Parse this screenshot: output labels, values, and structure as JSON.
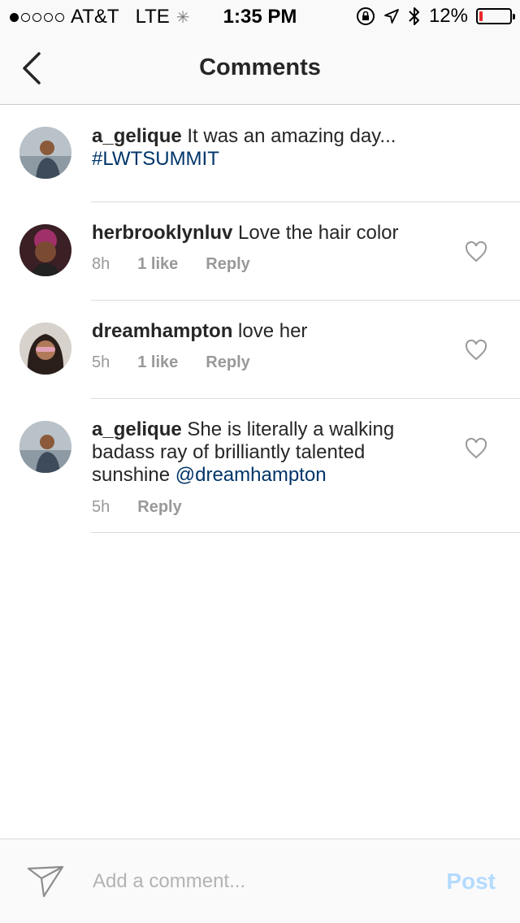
{
  "status_bar": {
    "carrier": "AT&T",
    "network": "LTE",
    "time": "1:35 PM",
    "battery": "12%",
    "battery_level": 0.12,
    "signal_bars": 1,
    "battery_color": "#e8282b"
  },
  "nav": {
    "title": "Comments",
    "back_icon": "chevron-left-icon"
  },
  "comments": [
    {
      "username": "a_gelique",
      "text": "It was an amazing day...",
      "link": "#LWTSUMMIT",
      "time": "",
      "likes": "",
      "reply": "",
      "avatar": "avatar-a-gelique"
    },
    {
      "username": "herbrooklynluv",
      "text": "Love the hair color",
      "time": "8h",
      "likes": "1 like",
      "reply": "Reply",
      "avatar": "avatar-herbrooklynluv"
    },
    {
      "username": "dreamhampton",
      "text": "love her",
      "time": "5h",
      "likes": "1 like",
      "reply": "Reply",
      "avatar": "avatar-dreamhampton"
    },
    {
      "username": "a_gelique",
      "text": "She is literally a walking badass ray of brilliantly talented sunshine",
      "mention": "@dreamhampton",
      "time": "5h",
      "likes": "",
      "reply": "Reply",
      "avatar": "avatar-a-gelique"
    }
  ],
  "composer": {
    "placeholder": "Add a comment...",
    "post_label": "Post",
    "send_icon": "send-icon"
  },
  "colors": {
    "link": "#003569",
    "meta": "#999999",
    "post_disabled": "#b3dbff"
  }
}
